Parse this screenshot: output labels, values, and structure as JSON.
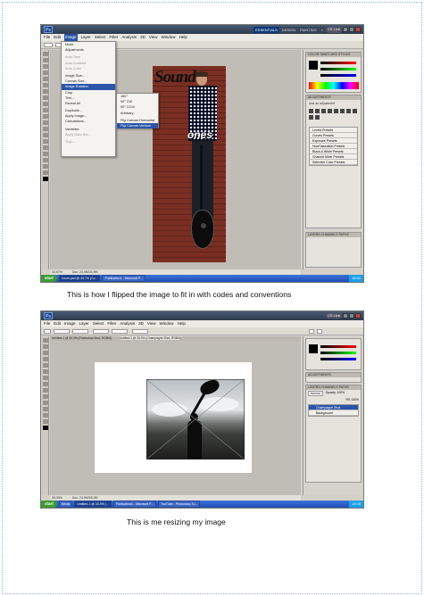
{
  "captions": {
    "first": "This is how I flipped the image to fit in with codes and conventions",
    "second": "This is me resizing my image"
  },
  "shot1": {
    "workspace_buttons": [
      "ESSENTIALS",
      "DESIGN",
      "PAINTING",
      "»"
    ],
    "cs_live": "CS Live",
    "menu": [
      "File",
      "Edit",
      "Image",
      "Layer",
      "Select",
      "Filter",
      "Analysis",
      "3D",
      "View",
      "Window",
      "Help"
    ],
    "active_menu": "Image",
    "image_menu": [
      "Mode",
      "Adjustments",
      "",
      "Auto Tone",
      "Auto Contrast",
      "Auto Color",
      "",
      "Image Size...",
      "Canvas Size...",
      "Image Rotation",
      "Crop",
      "Trim...",
      "Reveal All",
      "",
      "Duplicate...",
      "Apply Image...",
      "Calculations...",
      "",
      "Variables",
      "Apply Data Set...",
      "",
      "Trap..."
    ],
    "highlighted_menu_item": "Image Rotation",
    "rotation_submenu": [
      "180°",
      "90° CW",
      "90° CCW",
      "Arbitrary...",
      "",
      "Flip Canvas Horizontal",
      "Flip Canvas Vertical"
    ],
    "highlighted_submenu_item": "Flip Canvas Vertical",
    "magazine_title": "Sound",
    "overlay_text": "ones",
    "panel_tabs": [
      "COLOR",
      "SWATCHES",
      "STYLES"
    ],
    "adjustments_tab": "ADJUSTMENTS",
    "adjustments_hint": "Add an adjustment",
    "presets": [
      "Levels Presets",
      "Curves Presets",
      "Exposure Presets",
      "Hue/Saturation Presets",
      "Black & White Presets",
      "Channel Mixer Presets",
      "Selective Color Presets"
    ],
    "layers_tabs": [
      "LAYERS",
      "CHANNELS",
      "PATHS"
    ],
    "zoom": "33.67%",
    "doc_info": "Doc: 24.9M/24.9M",
    "taskbar": {
      "start": "start",
      "tasks": [
        "Cover.psd @ 33.7% (Co...",
        "Publication1 - Microsoft P..."
      ],
      "clock": "15:54"
    }
  },
  "shot2": {
    "menu": [
      "File",
      "Edit",
      "Image",
      "Layer",
      "Select",
      "Filter",
      "Analysis",
      "3D",
      "View",
      "Window",
      "Help"
    ],
    "cs_live": "CS Live",
    "doc_tabs": [
      "Untitled-1 @ 33.3% (Photoshop Shot, RGB/8)",
      "Untitled-1 @ 33.3% (Champagne Shot, RGB/8)"
    ],
    "layers": {
      "tabs": [
        "LAYERS",
        "CHANNELS",
        "PATHS"
      ],
      "blend": "Normal",
      "opacity": "Opacity: 100%",
      "fill": "Fill: 100%",
      "rows": [
        "Champagne Shot",
        "Background"
      ],
      "selected": "Champagne Shot"
    },
    "adjustments_tab": "ADJUSTMENTS",
    "zoom": "33.33%",
    "doc_info": "Doc: 24.9M/28.3M",
    "taskbar": {
      "start": "start",
      "tasks": [
        "Media",
        "Untitled-1 @ 33.3% (...",
        "Publication1 - Microsoft P...",
        "YouTube - Photoshop Tu..."
      ],
      "clock": "14:03"
    }
  },
  "colors": {
    "accent": "#2a55a8",
    "taskbar": "#1f4fb5",
    "start": "#3c9b34",
    "chrome": "#d4d0c8"
  }
}
